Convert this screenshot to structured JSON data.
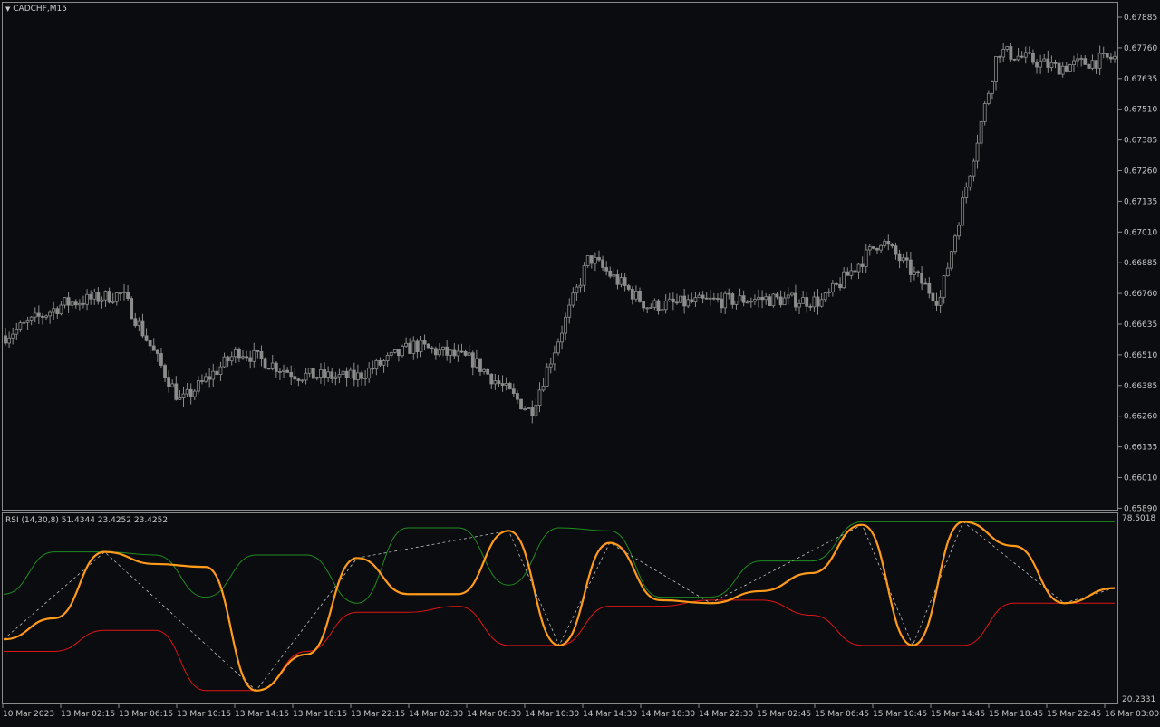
{
  "window": {
    "title": "CADCHF,M15"
  },
  "price_axis": {
    "labels": [
      "0.67885",
      "0.67760",
      "0.67635",
      "0.67510",
      "0.67385",
      "0.67260",
      "0.67135",
      "0.67010",
      "0.66885",
      "0.66760",
      "0.66635",
      "0.66510",
      "0.66385",
      "0.66260",
      "0.66135",
      "0.66010",
      "0.65890"
    ]
  },
  "indicator": {
    "label": "RSI (14,30,8) 51.4344 23.4252 23.4252",
    "axis_top": "78.5018",
    "axis_bottom": "20.2331"
  },
  "time_axis": {
    "labels": [
      "10 Mar 2023",
      "13 Mar 02:15",
      "13 Mar 06:15",
      "13 Mar 10:15",
      "13 Mar 14:15",
      "13 Mar 18:15",
      "13 Mar 22:15",
      "14 Mar 02:30",
      "14 Mar 06:30",
      "14 Mar 10:30",
      "14 Mar 14:30",
      "14 Mar 18:30",
      "14 Mar 22:30",
      "15 Mar 02:45",
      "15 Mar 06:45",
      "15 Mar 10:45",
      "15 Mar 14:45",
      "15 Mar 18:45",
      "15 Mar 22:45",
      "16 Mar 03:00"
    ]
  },
  "colors": {
    "background": "#0b0c10",
    "candle": "#8c8c8c",
    "rsi_line": "#ff9a1a",
    "upper_band": "#1f8c1f",
    "lower_band": "#e01414",
    "zigzag": "#bfbfbf",
    "text": "#c8c8c8"
  },
  "chart_data": [
    {
      "type": "candlestick",
      "symbol": "CADCHF",
      "timeframe": "M15",
      "ylim": [
        0.6589,
        0.67885
      ],
      "x": [
        "10 Mar 2023",
        "13 Mar 02:15",
        "13 Mar 06:15",
        "13 Mar 10:15",
        "13 Mar 14:15",
        "13 Mar 18:15",
        "13 Mar 22:15",
        "14 Mar 02:30",
        "14 Mar 06:30",
        "14 Mar 10:30",
        "14 Mar 14:30",
        "14 Mar 18:30",
        "14 Mar 22:30",
        "15 Mar 02:45",
        "15 Mar 06:45",
        "15 Mar 10:45",
        "15 Mar 14:45",
        "15 Mar 18:45",
        "15 Mar 22:45",
        "16 Mar 03:00"
      ],
      "close_approx": [
        0.6659,
        0.6672,
        0.6676,
        0.6632,
        0.6653,
        0.6643,
        0.6642,
        0.6655,
        0.6649,
        0.6628,
        0.6691,
        0.6671,
        0.6673,
        0.6674,
        0.6673,
        0.6698,
        0.6673,
        0.6775,
        0.6768,
        0.6772
      ],
      "grid": false
    },
    {
      "type": "line",
      "name": "RSI (14,30,8)",
      "ylim": [
        20.2331,
        78.5018
      ],
      "current_values": [
        51.4344,
        23.4252,
        23.4252
      ],
      "series": [
        {
          "name": "RSI",
          "values": [
            40,
            47,
            69,
            65,
            64,
            23,
            35,
            67,
            55,
            55,
            76,
            38,
            72,
            53,
            52,
            56,
            62,
            78,
            38,
            79,
            71,
            52,
            57
          ]
        },
        {
          "name": "Upper",
          "values": [
            55,
            69,
            69,
            68,
            54,
            68,
            68,
            52,
            77,
            77,
            58,
            77,
            76,
            54,
            54,
            66,
            66,
            79,
            79,
            79,
            79,
            79,
            79
          ]
        },
        {
          "name": "Lower",
          "values": [
            36,
            36,
            43,
            43,
            23,
            23,
            36,
            49,
            49,
            51,
            38,
            38,
            51,
            51,
            53,
            53,
            48,
            38,
            38,
            38,
            52,
            52,
            52
          ]
        }
      ],
      "legend": "top-left"
    }
  ]
}
